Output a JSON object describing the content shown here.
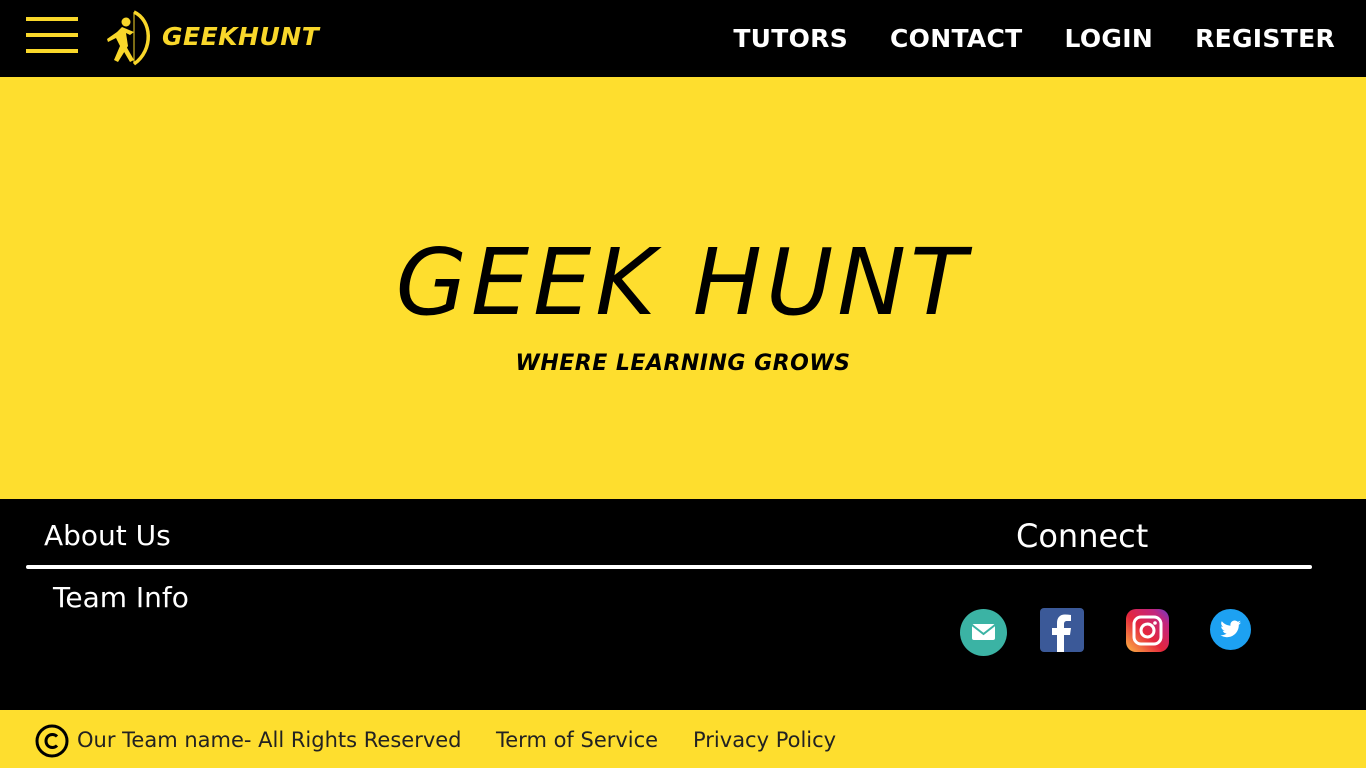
{
  "header": {
    "brand": "GEEKHUNT",
    "menu_icon": "hamburger-menu-icon",
    "logo_icon": "archer-logo-icon",
    "nav": [
      {
        "label": "TUTORS"
      },
      {
        "label": "CONTACT"
      },
      {
        "label": "LOGIN"
      },
      {
        "label": "REGISTER"
      }
    ]
  },
  "hero": {
    "title": "GEEK HUNT",
    "subtitle": "WHERE LEARNING GROWS"
  },
  "footer": {
    "about_us": "About Us",
    "connect": "Connect",
    "team_info": "Team Info",
    "social": [
      {
        "icon": "email-icon",
        "color": "#3bb3a4"
      },
      {
        "icon": "facebook-icon",
        "color": "#3b5998"
      },
      {
        "icon": "instagram-icon",
        "color": "#d6297b"
      },
      {
        "icon": "twitter-icon",
        "color": "#1da1f2"
      }
    ]
  },
  "bottom": {
    "copyright_icon": "copyright-icon",
    "copyright": "Our Team name- All Rights Reserved",
    "terms": "Term of Service",
    "privacy": "Privacy Policy"
  },
  "colors": {
    "accent_yellow": "#fede2e",
    "logo_yellow": "#f9d72a",
    "dark": "#000000"
  }
}
